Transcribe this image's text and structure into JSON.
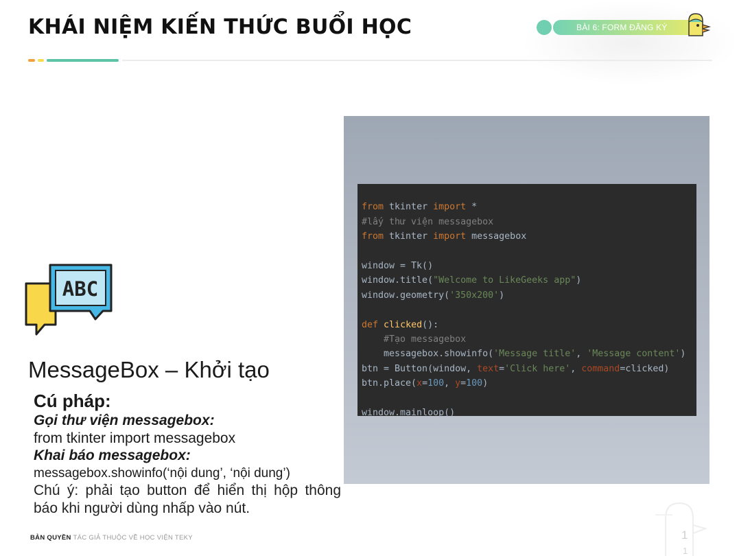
{
  "header": {
    "title": "KHÁI NIỆM KIẾN THỨC BUỔI HỌC",
    "lesson_badge": "BÀI 6: FORM ĐĂNG KÝ"
  },
  "colors": {
    "accent_orange": "#f2a23a",
    "accent_yellow": "#f6dd4a",
    "accent_teal": "#5cc3a6",
    "code_bg": "#2b2b2b"
  },
  "icons": [
    "abc-chat-icon",
    "mascot-icon"
  ],
  "main": {
    "heading": "MessageBox – Khởi tạo",
    "syntax_label": "Cú pháp:",
    "import_label": "Gọi thư viện messagebox:",
    "import_code": "from tkinter import messagebox",
    "declare_label_prefix": "Khai báo ",
    "declare_label_word": "messagebox:",
    "declare_code": "messagebox.showinfo(‘nội dung’, ‘nội dung’)",
    "note": "Chú ý: phải tạo button để hiển thị hộp thông báo khi người dùng nhấp vào nút."
  },
  "code": {
    "lines": [
      "from tkinter import *",
      "#lấy thư viện messagebox",
      "from tkinter import messagebox",
      "",
      "window = Tk()",
      "window.title(\"Welcome to LikeGeeks app\")",
      "window.geometry('350x200')",
      "",
      "def clicked():",
      "    #Tạo messagebox",
      "    messagebox.showinfo('Message title', 'Message content')",
      "btn = Button(window, text='Click here', command=clicked)",
      "btn.place(x=100, y=100)",
      "",
      "window.mainloop()"
    ]
  },
  "footer": {
    "copyright_bold": "BẢN QUYỀN",
    "copyright_rest": "TÁC GIẢ THUỘC VỀ HỌC VIỆN TEKY",
    "page_number": "1",
    "page_number_2": "1"
  }
}
